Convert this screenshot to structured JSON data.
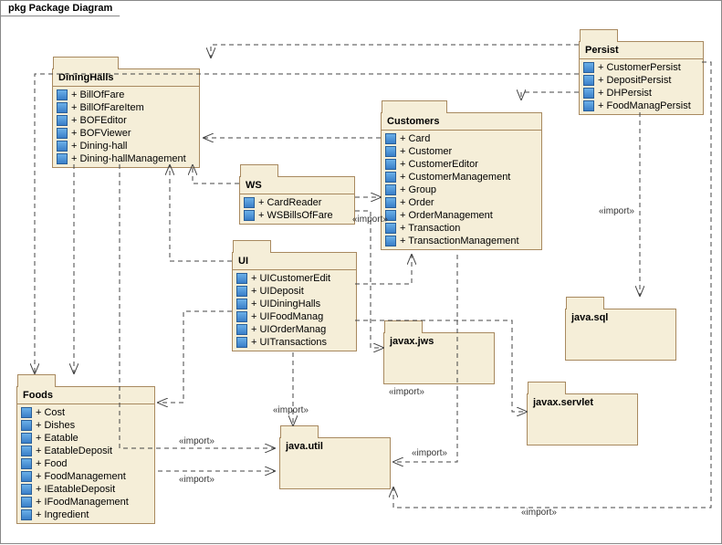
{
  "frame": {
    "title": "pkg Package Diagram"
  },
  "packages": {
    "dininghalls": {
      "name": "DiningHalls",
      "items": [
        "+ BillOfFare",
        "+ BillOfFareItem",
        "+ BOFEditor",
        "+ BOFViewer",
        "+ Dining-hall",
        "+ Dining-hallManagement"
      ]
    },
    "persist": {
      "name": "Persist",
      "items": [
        "+ CustomerPersist",
        "+ DepositPersist",
        "+ DHPersist",
        "+ FoodManagPersist"
      ]
    },
    "customers": {
      "name": "Customers",
      "items": [
        "+ Card",
        "+ Customer",
        "+ CustomerEditor",
        "+ CustomerManagement",
        "+ Group",
        "+ Order",
        "+ OrderManagement",
        "+ Transaction",
        "+ TransactionManagement"
      ]
    },
    "ws": {
      "name": "WS",
      "items": [
        "+ CardReader",
        "+ WSBillsOfFare"
      ]
    },
    "ui": {
      "name": "UI",
      "items": [
        "+ UICustomerEdit",
        "+ UIDeposit",
        "+ UIDiningHalls",
        "+ UIFoodManag",
        "+ UIOrderManag",
        "+ UITransactions"
      ]
    },
    "foods": {
      "name": "Foods",
      "items": [
        "+ Cost",
        "+ Dishes",
        "+ Eatable",
        "+ EatableDeposit",
        "+ Food",
        "+ FoodManagement",
        "+ IEatableDeposit",
        "+ IFoodManagement",
        "+ Ingredient"
      ]
    },
    "javasql": {
      "name": "java.sql"
    },
    "javaxjws": {
      "name": "javax.jws"
    },
    "javautil": {
      "name": "java.util"
    },
    "javaxservlet": {
      "name": "javax.servlet"
    }
  },
  "labels": {
    "import": "«import»"
  }
}
